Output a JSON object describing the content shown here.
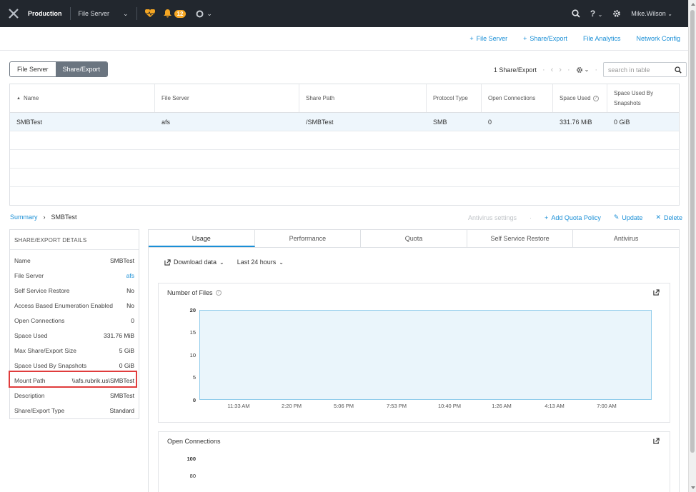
{
  "topbar": {
    "cluster": "Production",
    "entity": "File Server",
    "alert_count": "12",
    "user": "Mike.Wilson"
  },
  "actions": {
    "add_file_server": "File Server",
    "add_share": "Share/Export",
    "file_analytics": "File Analytics",
    "network_config": "Network Config"
  },
  "view_toggle": {
    "file_server": "File Server",
    "share_export": "Share/Export"
  },
  "table_tools": {
    "count": "1 Share/Export",
    "search_placeholder": "search in table"
  },
  "table": {
    "headers": [
      "Name",
      "File Server",
      "Share Path",
      "Protocol Type",
      "Open Connections",
      "Space Used",
      "Space Used By Snapshots"
    ],
    "rows": [
      [
        "SMBTest",
        "afs",
        "/SMBTest",
        "SMB",
        "0",
        "331.76 MiB",
        "0 GiB"
      ]
    ]
  },
  "breadcrumb": {
    "root": "Summary",
    "current": "SMBTest"
  },
  "detail_actions": {
    "antivirus_settings": "Antivirus settings",
    "add_quota": "Add Quota Policy",
    "update": "Update",
    "delete": "Delete"
  },
  "details": {
    "title": "SHARE/EXPORT DETAILS",
    "rows": [
      {
        "k": "Name",
        "v": "SMBTest"
      },
      {
        "k": "File Server",
        "v": "afs"
      },
      {
        "k": "Self Service Restore",
        "v": "No"
      },
      {
        "k": "Access Based Enumeration Enabled",
        "v": "No"
      },
      {
        "k": "Open Connections",
        "v": "0"
      },
      {
        "k": "Space Used",
        "v": "331.76 MiB"
      },
      {
        "k": "Max Share/Export Size",
        "v": "5 GiB"
      },
      {
        "k": "Space Used By Snapshots",
        "v": "0 GiB"
      },
      {
        "k": "Mount Path",
        "v": "\\\\afs.rubrik.us\\SMBTest"
      },
      {
        "k": "Description",
        "v": "SMBTest"
      },
      {
        "k": "Share/Export Type",
        "v": "Standard"
      }
    ]
  },
  "tabs": [
    "Usage",
    "Performance",
    "Quota",
    "Self Service Restore",
    "Antivirus"
  ],
  "usage": {
    "download": "Download data",
    "range": "Last 24 hours"
  },
  "charts": {
    "files_title": "Number of Files",
    "files_y": [
      "20",
      "15",
      "10",
      "5",
      "0"
    ],
    "files_x": [
      "11:33 AM",
      "2:20 PM",
      "5:06 PM",
      "7:53 PM",
      "10:40 PM",
      "1:26 AM",
      "4:13 AM",
      "7:00 AM"
    ],
    "conn_title": "Open Connections",
    "conn_y": [
      "100",
      "80"
    ]
  },
  "colors": {
    "accent": "#1a8fd6",
    "topbar": "#22272e",
    "highlight": "#e03c3c",
    "chart_fill": "#eaf5fb",
    "chart_line": "#8fcbea"
  }
}
